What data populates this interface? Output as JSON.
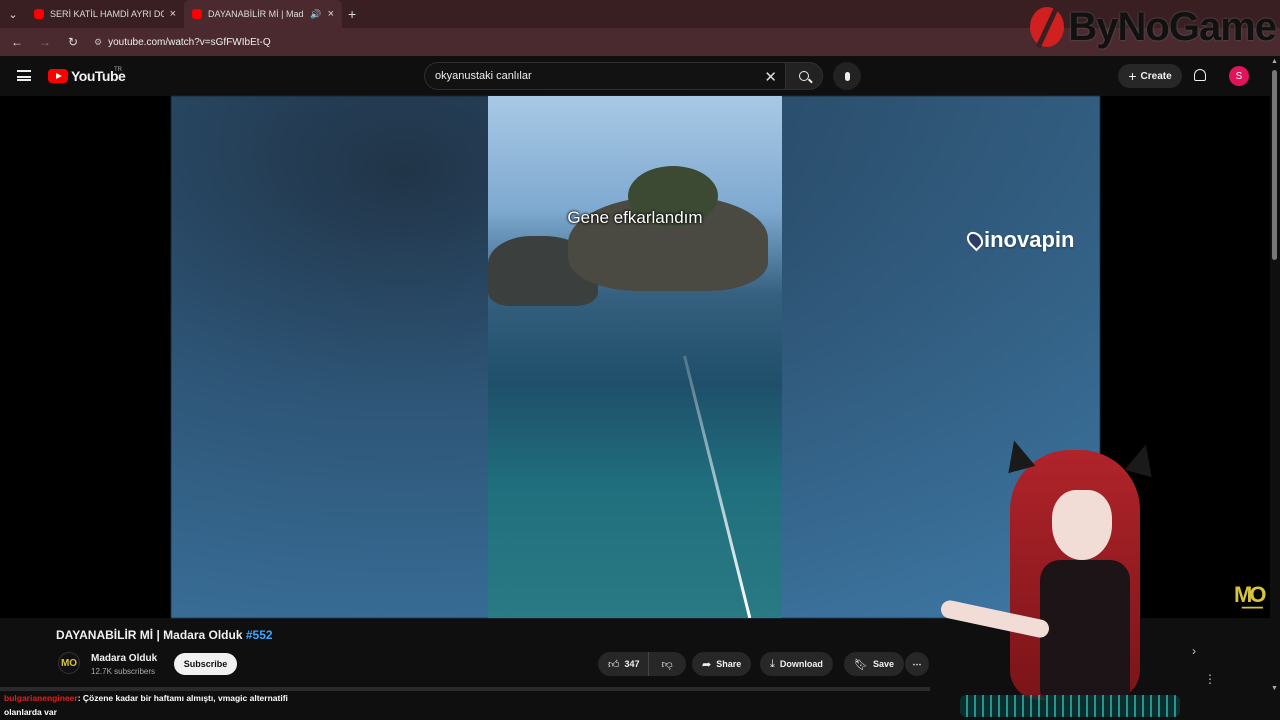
{
  "browser": {
    "tabs": [
      {
        "title": "SERİ KATİL HAMDİ AYRI DOSYA",
        "active": false
      },
      {
        "title": "DAYANABİLİR Mİ | Madara",
        "active": true
      }
    ],
    "url": "youtube.com/watch?v=sGfFWIbEt-Q"
  },
  "watermark": {
    "text": "ByNoGame"
  },
  "header": {
    "logo": "YouTube",
    "region": "TR",
    "search_value": "okyanustaki canlılar",
    "create_label": "Create",
    "avatar_letter": "S"
  },
  "video": {
    "caption": "Gene efkarlandım",
    "sponsor": "inovapin",
    "channel_logo": "M͟O"
  },
  "details": {
    "title": "DAYANABİLİR Mİ | Madara Olduk ",
    "hashtag": "#552",
    "channel_name": "Madara Olduk",
    "subscribers": "12.7K subscribers",
    "subscribe_label": "Subscribe",
    "likes": "347",
    "share_label": "Share",
    "download_label": "Download",
    "save_label": "Save",
    "more_label": "⋯"
  },
  "chat": {
    "user": "bulgarianengineer",
    "message": ": Çözene kadar bir haftamı almıştı, vmagic alternatifi olanlarda var"
  },
  "colors": {
    "accent": "#ff0000",
    "link": "#3ea6ff",
    "avatar": "#e0135b"
  }
}
